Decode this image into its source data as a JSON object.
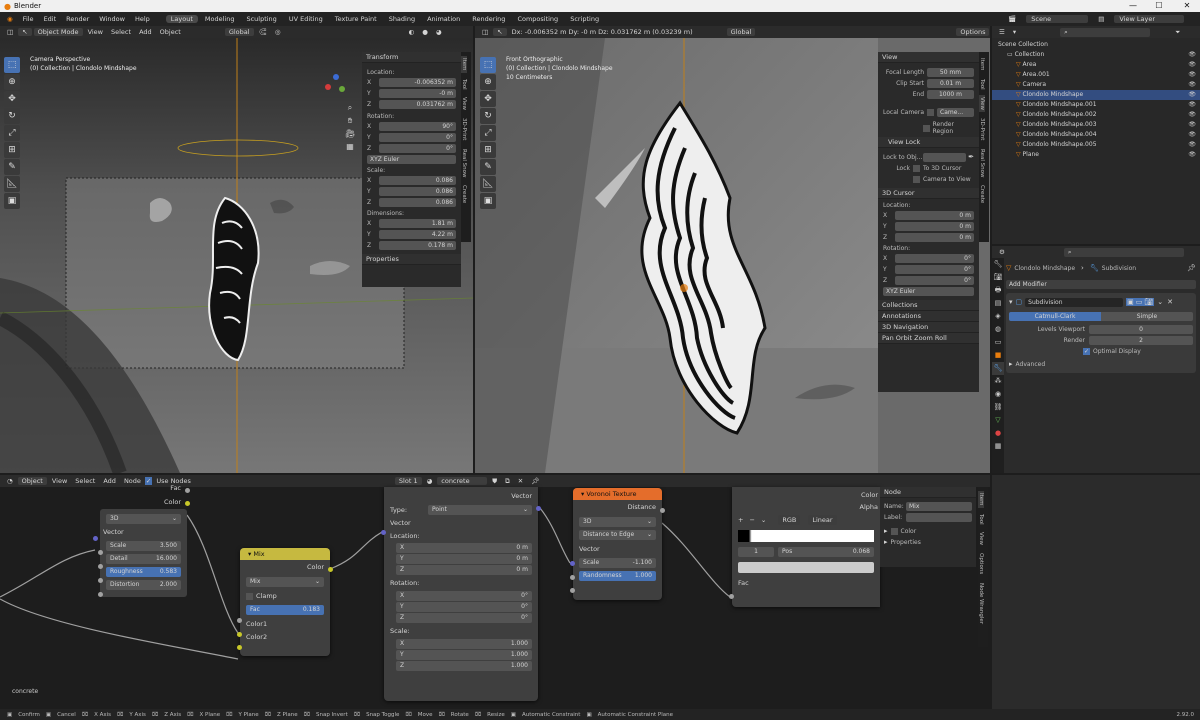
{
  "window": {
    "title": "Blender"
  },
  "menus": [
    "File",
    "Edit",
    "Render",
    "Window",
    "Help"
  ],
  "workspaces": [
    "Layout",
    "Modeling",
    "Sculpting",
    "UV Editing",
    "Texture Paint",
    "Shading",
    "Animation",
    "Rendering",
    "Compositing",
    "Scripting"
  ],
  "top": {
    "scene": "Scene",
    "view_layer": "View Layer"
  },
  "vp1": {
    "mode": "Object Mode",
    "menus": [
      "View",
      "Select",
      "Add",
      "Object"
    ],
    "transform": "Global",
    "info1": "Camera Perspective",
    "info2": "(0) Collection | Clondolo Mindshape",
    "options": "Options",
    "npanel": {
      "title": "Transform",
      "location_label": "Location:",
      "loc": [
        "-0.006352 m",
        "-0 m",
        "0.031762 m"
      ],
      "rotation_label": "Rotation:",
      "rot": [
        "90°",
        "0°",
        "0°"
      ],
      "rot_mode": "XYZ Euler",
      "scale_label": "Scale:",
      "scale": [
        "0.086",
        "0.086",
        "0.086"
      ],
      "dimensions_label": "Dimensions:",
      "dim": [
        "1.81 m",
        "4.22 m",
        "0.178 m"
      ],
      "properties": "Properties"
    },
    "tabs": [
      "Item",
      "Tool",
      "View",
      "3D-Print",
      "Real Snow",
      "Create"
    ]
  },
  "vp2": {
    "header_info": "Dx: -0.006352 m  Dy: -0 m  Dz: 0.031762 m (0.03239 m)",
    "transform": "Global",
    "options": "Options",
    "info1": "Front Orthographic",
    "info2": "(0) Collection | Clondolo Mindshape",
    "info3": "10 Centimeters",
    "view": {
      "title": "View",
      "focal_label": "Focal Length",
      "focal": "50 mm",
      "clip_start_label": "Clip Start",
      "clip_start": "0.01 m",
      "end_label": "End",
      "end": "1000 m",
      "local_camera": "Local Camera",
      "camera_btn": "Came...",
      "render_region": "Render Region",
      "view_lock": "View Lock",
      "lock_obj": "Lock to Obj...",
      "lock": "Lock",
      "to3d": "To 3D Cursor",
      "camview": "Camera to View"
    },
    "cursor": {
      "title": "3D Cursor",
      "location_label": "Location:",
      "loc": [
        "0 m",
        "0 m",
        "0 m"
      ],
      "rotation_label": "Rotation:",
      "rot": [
        "0°",
        "0°",
        "0°"
      ],
      "rot_mode": "XYZ Euler"
    },
    "extra": [
      "Collections",
      "Annotations",
      "3D Navigation",
      "Pan Orbit Zoom Roll"
    ],
    "tabs": [
      "Item",
      "Tool",
      "View",
      "3D-Print",
      "Real Snow",
      "Create"
    ]
  },
  "outliner": {
    "root": "Scene Collection",
    "items": [
      {
        "n": "Collection",
        "d": 1
      },
      {
        "n": "Area",
        "d": 2
      },
      {
        "n": "Area.001",
        "d": 2
      },
      {
        "n": "Camera",
        "d": 2
      },
      {
        "n": "Clondolo Mindshape",
        "d": 2,
        "sel": true
      },
      {
        "n": "Clondolo Mindshape.001",
        "d": 2
      },
      {
        "n": "Clondolo Mindshape.002",
        "d": 2
      },
      {
        "n": "Clondolo Mindshape.003",
        "d": 2
      },
      {
        "n": "Clondolo Mindshape.004",
        "d": 2
      },
      {
        "n": "Clondolo Mindshape.005",
        "d": 2
      },
      {
        "n": "Plane",
        "d": 2
      }
    ]
  },
  "props": {
    "object": "Clondolo Mindshape",
    "modifier_path": "Subdivision",
    "add_modifier": "Add Modifier",
    "mod_name": "Subdivision",
    "catmull": "Catmull-Clark",
    "simple": "Simple",
    "levels_label": "Levels Viewport",
    "levels": "0",
    "render_label": "Render",
    "render": "2",
    "optimal": "Optimal Display",
    "advanced": "Advanced"
  },
  "node_editor": {
    "menus": [
      "View",
      "Select",
      "Add",
      "Node"
    ],
    "mode": "Object",
    "use_nodes": "Use Nodes",
    "slot": "Slot 1",
    "material": "concrete",
    "material_label": "concrete",
    "noise": {
      "fac": "Fac",
      "color": "Color",
      "dim": "3D",
      "vector": "Vector",
      "scale_label": "Scale",
      "scale": "3.500",
      "detail_label": "Detail",
      "detail": "16.000",
      "rough_label": "Roughness",
      "rough": "0.583",
      "dist_label": "Distortion",
      "dist": "2.000"
    },
    "mix": {
      "title": "Mix",
      "color": "Color",
      "blend": "Mix",
      "clamp": "Clamp",
      "fac_label": "Fac",
      "fac": "0.183",
      "c1": "Color1",
      "c2": "Color2"
    },
    "mapping": {
      "vector_out": "Vector",
      "type_label": "Type:",
      "type": "Point",
      "vector": "Vector",
      "location_label": "Location:",
      "loc": [
        "0 m",
        "0 m",
        "0 m"
      ],
      "rotation_label": "Rotation:",
      "rot": [
        "0°",
        "0°",
        "0°"
      ],
      "scale_label": "Scale:",
      "scale": [
        "1.000",
        "1.000",
        "1.000"
      ]
    },
    "voronoi": {
      "title": "Voronoi Texture",
      "distance": "Distance",
      "dim": "3D",
      "feature": "Distance to Edge",
      "vector": "Vector",
      "scale_label": "Scale",
      "scale": "-1.100",
      "rand_label": "Randomness",
      "rand": "1.000"
    },
    "ramp": {
      "color": "Color",
      "alpha": "Alpha",
      "mode": "RGB",
      "interp": "Linear",
      "idx": "1",
      "pos_label": "Pos",
      "pos": "0.068",
      "fac": "Fac"
    },
    "npanel": {
      "node_title": "Node",
      "name_label": "Name:",
      "name": "Mix",
      "label_label": "Label:",
      "color": "Color",
      "properties": "Properties",
      "tabs": [
        "Item",
        "Tool",
        "View",
        "Options",
        "Node Wrangler"
      ]
    }
  },
  "status": {
    "items": [
      "Confirm",
      "Cancel",
      "X Axis",
      "Y Axis",
      "Z Axis",
      "X Plane",
      "Y Plane",
      "Z Plane",
      "Snap Invert",
      "Snap Toggle",
      "Move",
      "Rotate",
      "Resize",
      "Automatic Constraint",
      "Automatic Constraint Plane"
    ],
    "version": "2.92.0"
  }
}
